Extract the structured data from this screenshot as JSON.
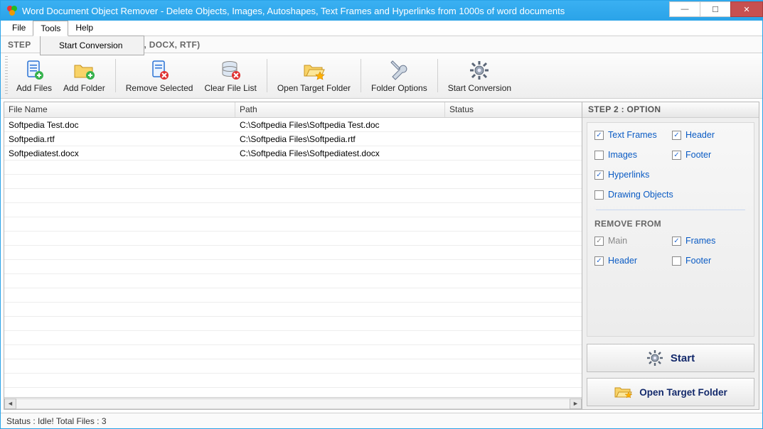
{
  "window": {
    "title": "Word Document Object Remover - Delete Objects, Images, Autoshapes, Text Frames and Hyperlinks from 1000s of word documents"
  },
  "menu": {
    "file": "File",
    "tools": "Tools",
    "help": "Help",
    "tools_dropdown": {
      "start_conversion": "Start Conversion"
    }
  },
  "step1": {
    "visible_fragment_left": "STEP",
    "visible_fragment_right": "C, DOCX, RTF)"
  },
  "toolbar": {
    "add_files": "Add Files",
    "add_folder": "Add Folder",
    "remove_selected": "Remove Selected",
    "clear_file_list": "Clear File List",
    "open_target_folder": "Open Target Folder",
    "folder_options": "Folder Options",
    "start_conversion": "Start Conversion"
  },
  "grid": {
    "headers": {
      "file_name": "File Name",
      "path": "Path",
      "status": "Status"
    },
    "rows": [
      {
        "file_name": "Softpedia Test.doc",
        "path": "C:\\Softpedia Files\\Softpedia Test.doc",
        "status": ""
      },
      {
        "file_name": "Softpedia.rtf",
        "path": "C:\\Softpedia Files\\Softpedia.rtf",
        "status": ""
      },
      {
        "file_name": "Softpediatest.docx",
        "path": "C:\\Softpedia Files\\Softpediatest.docx",
        "status": ""
      }
    ]
  },
  "side": {
    "header": "STEP 2 : OPTION",
    "options": {
      "text_frames": {
        "label": "Text Frames",
        "checked": true
      },
      "header": {
        "label": "Header",
        "checked": true
      },
      "images": {
        "label": "Images",
        "checked": false
      },
      "footer": {
        "label": "Footer",
        "checked": true
      },
      "hyperlinks": {
        "label": "Hyperlinks",
        "checked": true
      },
      "drawing_objects": {
        "label": "Drawing Objects",
        "checked": false
      }
    },
    "remove_from_header": "REMOVE FROM",
    "remove_from": {
      "main": {
        "label": "Main",
        "checked": true,
        "disabled": true
      },
      "frames": {
        "label": "Frames",
        "checked": true,
        "disabled": false
      },
      "header": {
        "label": "Header",
        "checked": true,
        "disabled": false
      },
      "footer": {
        "label": "Footer",
        "checked": false,
        "disabled": false
      }
    },
    "start_button": "Start",
    "open_target_button": "Open Target Folder"
  },
  "statusbar": {
    "text": "Status  :  Idle!  Total Files : 3"
  }
}
